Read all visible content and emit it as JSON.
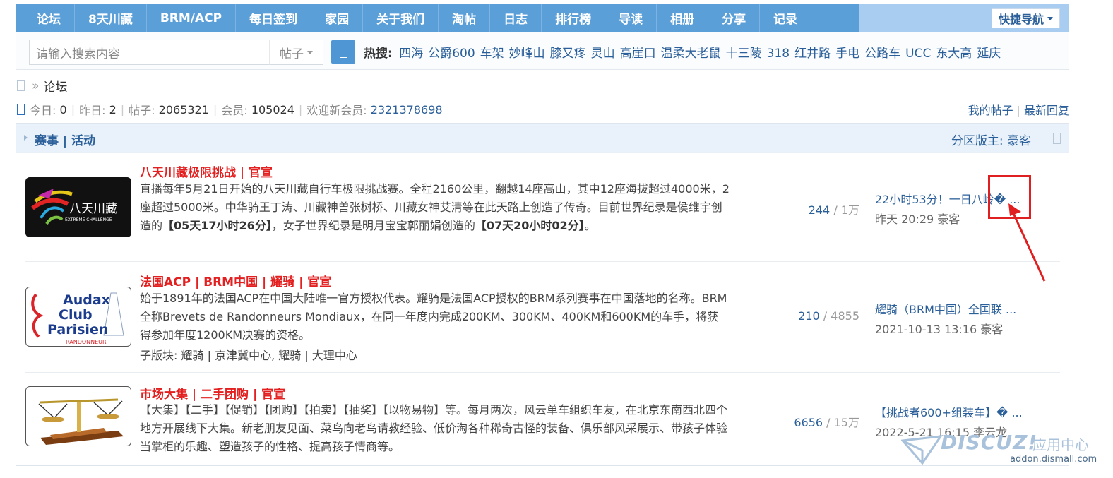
{
  "nav": {
    "items": [
      "论坛",
      "8天川藏",
      "BRM/ACP",
      "每日签到",
      "家园",
      "关于我们",
      "淘帖",
      "日志",
      "排行榜",
      "导读",
      "相册",
      "分享",
      "记录"
    ],
    "quick_nav": "快捷导航"
  },
  "search": {
    "placeholder": "请输入搜索内容",
    "type": "帖子",
    "hot_label": "热搜:",
    "hot": [
      "四海",
      "公爵600",
      "车架",
      "妙峰山",
      "膝又疼",
      "灵山",
      "高崖口",
      "温柔大老鼠",
      "十三陵",
      "318",
      "红井路",
      "手电",
      "公路车",
      "UCC",
      "东大高",
      "延庆"
    ]
  },
  "breadcrumb": {
    "sep": "»",
    "current": "论坛"
  },
  "stats": {
    "today_label": "今日:",
    "today": "0",
    "yesterday_label": "昨日:",
    "yesterday": "2",
    "posts_label": "帖子:",
    "posts": "2065321",
    "members_label": "会员:",
    "members": "105024",
    "new_member_label": "欢迎新会员:",
    "new_member": "2321378698"
  },
  "links": {
    "my_posts": "我的帖子",
    "latest_replies": "最新回复"
  },
  "section": {
    "title": "赛事 | 活动",
    "moderator_label": "分区版主:",
    "moderator": "豪客"
  },
  "forums": [
    {
      "title": "八天川藏极限挑战 | 官宣",
      "desc_a": "直播每年5月21日开始的八天川藏自行车极限挑战赛。全程2160公里，翻越14座高山，其中12座海拔超过4000米，2座超过5000米。中华骑王丁涛、川藏神兽张树桥、川藏女神艾清等在此天路上创造了传奇。目前世界纪录是侯维宇创造的",
      "desc_b": "【05天17小时26分】",
      "desc_c": "，女子世界纪录是明月宝宝郭丽娟创造的",
      "desc_d": "【07天20小时02分】",
      "desc_e": "。",
      "threads": "244",
      "posts": "1万",
      "last_title": "22小时53分！一日八岭� ...",
      "last_meta": "昨天 20:29 豪客",
      "logo_main": "八天川藏",
      "logo_sub": "EXTREME CHALLENGE"
    },
    {
      "title": "法国ACP | BRM中国 | 耀骑 | 官宣",
      "desc": "始于1891年的法国ACP在中国大陆唯一官方授权代表。耀骑是法国ACP授权的BRM系列赛事在中国落地的名称。BRM全称Brevets de Randonneurs Mondiaux，在同一年度内完成200KM、300KM、400KM和600KM的车手，将获得参加年度1200KM决赛的资格。",
      "sub_label": "子版块:",
      "sub": "耀骑 | 京津冀中心, 耀骑 | 大理中心",
      "threads": "210",
      "posts": "4855",
      "last_title": "耀骑（BRM中国）全国联 ...",
      "last_meta": "2021-10-13 13:16 豪客",
      "logo_lines": [
        "Audax",
        "Club",
        "Parisien"
      ],
      "logo_sub": "RANDONNEUR"
    },
    {
      "title": "市场大集 | 二手团购 | 官宣",
      "desc": "【大集】【二手】【促销】【团购】【拍卖】【抽奖】【以物易物】等。每月两次，风云单车组织车友，在北京东南西北四个地方开展线下大集。新老朋友见面、菜鸟向老鸟请教经验、低价淘各种稀奇古怪的装备、俱乐部风采展示、带孩子体验当掌柜的乐趣、塑造孩子的性格、提高孩子情商等。",
      "threads": "6656",
      "posts": "15万",
      "last_title": "【挑战者600+组装车】� ...",
      "last_meta": "2022-5-21 16:15 李云龙"
    }
  ],
  "watermark": {
    "brand": "DISCUZ!",
    "cn": "应用中心",
    "url": "addon.dismall.com"
  },
  "colors": {
    "nav_bg": "#5b9fd9",
    "link": "#2b5f99",
    "forum_title": "#e31f1f",
    "annotation": "#e02020"
  }
}
